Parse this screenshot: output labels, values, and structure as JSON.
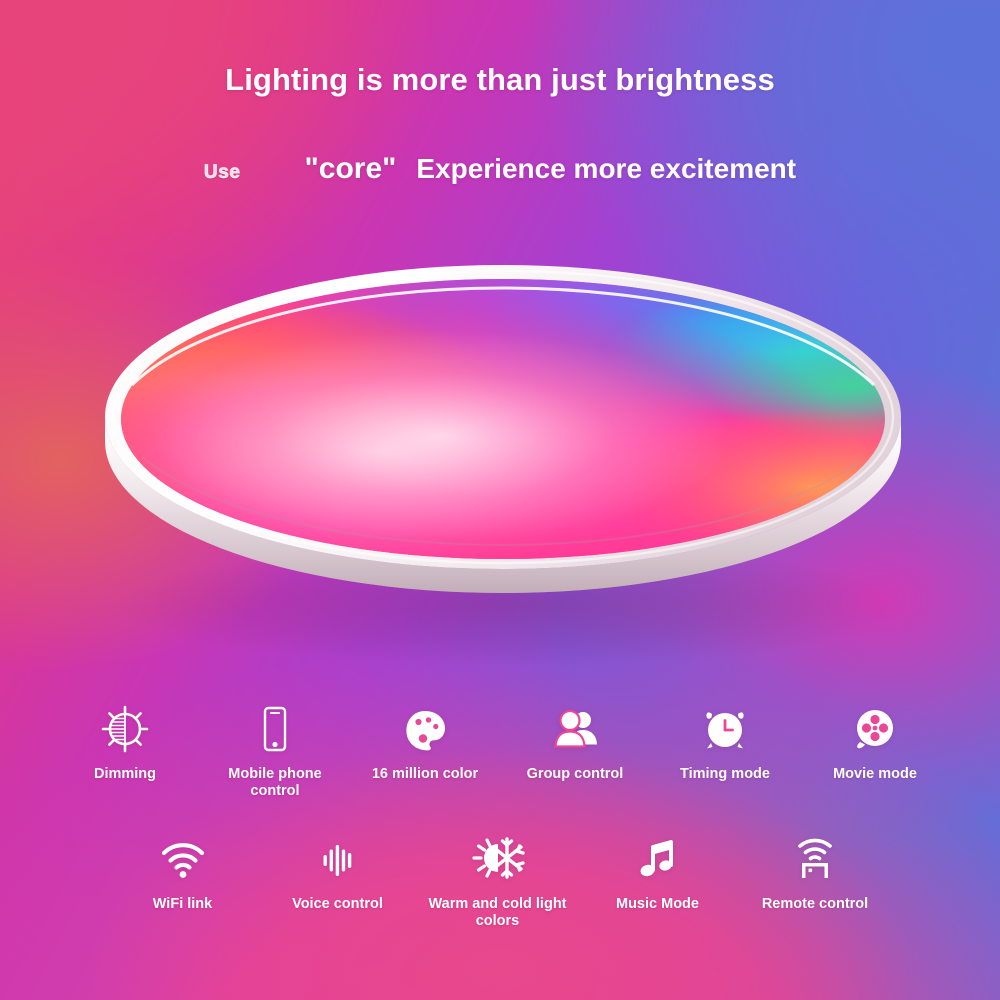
{
  "headline": {
    "line1": "Lighting is more than just brightness",
    "use_word": "Use",
    "quoted_word": "\"core\"",
    "line2_rest": "Experience more excitement"
  },
  "colors": {
    "bg_pink": "#e8447c",
    "bg_magenta": "#e0368c",
    "bg_purple": "#a341d2",
    "bg_blue": "#5a73d8",
    "bg_hot_pink": "#ee3f94",
    "text_white": "#ffffff",
    "lamp_body_white": "#f4f0f2"
  },
  "product": {
    "name": "rgb-ceiling-lamp",
    "diffuser_colors": [
      "#ff8a2a",
      "#ff3f63",
      "#ff2fa0",
      "#e040e8",
      "#9a4ff0",
      "#4f7bf0",
      "#2ec9e0",
      "#3ecfa0"
    ]
  },
  "features": {
    "row1": [
      {
        "label": "Dimming",
        "icon": "dimming-icon"
      },
      {
        "label": "Mobile phone\ncontrol",
        "icon": "mobile-phone-icon"
      },
      {
        "label": "16 million color",
        "icon": "color-palette-icon"
      },
      {
        "label": "Group control",
        "icon": "group-people-icon"
      },
      {
        "label": "Timing mode",
        "icon": "alarm-clock-icon"
      },
      {
        "label": "Movie mode",
        "icon": "film-reel-icon"
      }
    ],
    "row2": [
      {
        "label": "WiFi link",
        "icon": "wifi-icon"
      },
      {
        "label": "Voice control",
        "icon": "voice-waveform-icon"
      },
      {
        "label": "Warm and cold light\ncolors",
        "icon": "sun-snowflake-icon"
      },
      {
        "label": "Music Mode",
        "icon": "music-note-icon"
      },
      {
        "label": "Remote control",
        "icon": "remote-router-icon"
      }
    ]
  }
}
